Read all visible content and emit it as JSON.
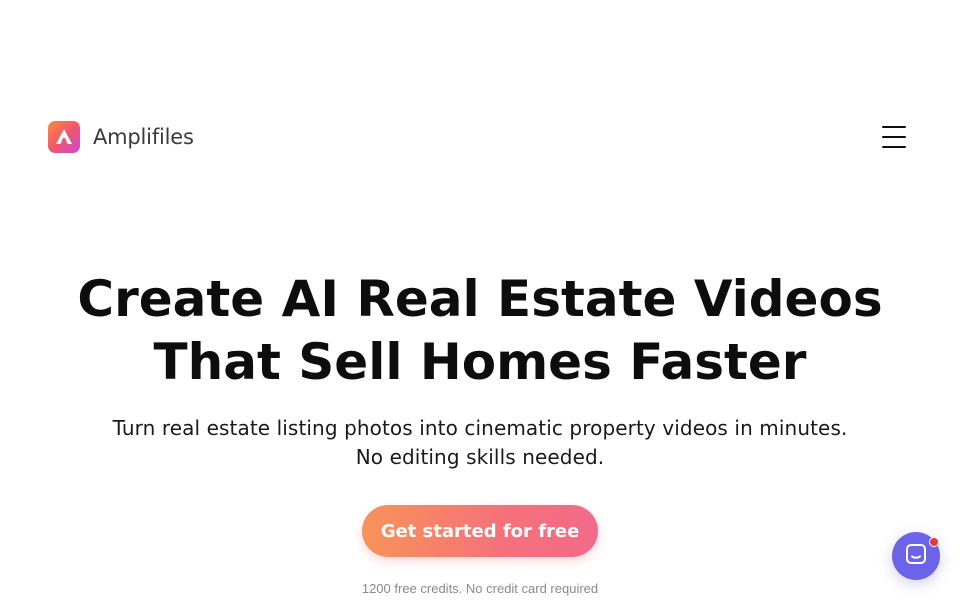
{
  "header": {
    "brand_name": "Amplifiles",
    "logo_icon": "amplifiles-logo-icon",
    "menu_icon": "hamburger-menu-icon"
  },
  "hero": {
    "title_line_1": "Create AI Real Estate Videos",
    "title_line_2": "That Sell Homes Faster",
    "subtitle_line_1": "Turn real estate listing photos into cinematic property videos in minutes.",
    "subtitle_line_2": "No editing skills needed.",
    "cta_label": "Get started for free",
    "cta_note": "1200 free credits. No credit card required"
  },
  "chat_widget": {
    "icon": "chat-icon",
    "has_notification": true
  },
  "colors": {
    "cta_gradient_start": "#f7935a",
    "cta_gradient_end": "#f16a8a",
    "logo_gradient": [
      "#ff8a3d",
      "#f0566f",
      "#c94bd6"
    ],
    "chat_launcher": "#6b63e8",
    "notification_dot": "#e53935"
  }
}
